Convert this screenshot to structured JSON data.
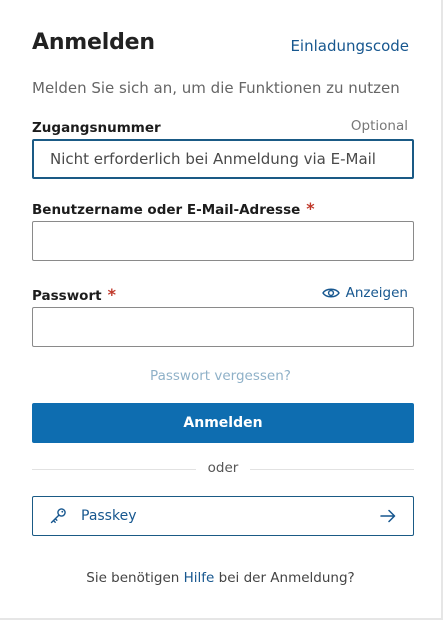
{
  "header": {
    "title": "Anmelden",
    "invite_link": "Einladungscode"
  },
  "subtitle": "Melden Sie sich an, um die Funktionen zu nutzen",
  "access_number": {
    "label": "Zugangsnummer",
    "optional_label": "Optional",
    "placeholder": "Nicht erforderlich bei Anmeldung via E-Mail",
    "value": ""
  },
  "username": {
    "label": "Benutzername oder E-Mail-Adresse",
    "required_mark": "*",
    "value": ""
  },
  "password": {
    "label": "Passwort",
    "required_mark": "*",
    "show_label": "Anzeigen",
    "value": ""
  },
  "forgot_password": "Passwort vergessen?",
  "login_button": "Anmelden",
  "divider_text": "oder",
  "passkey_button": "Passkey",
  "help": {
    "prefix": "Sie benötigen",
    "link": "Hilfe",
    "suffix": "bei der Anmeldung?"
  },
  "colors": {
    "primary": "#0e6db0",
    "link": "#17578f",
    "required": "#c0392b",
    "muted_link": "#8fb1c8"
  },
  "icons": [
    "eye-icon",
    "key-icon",
    "arrow-right-icon"
  ]
}
